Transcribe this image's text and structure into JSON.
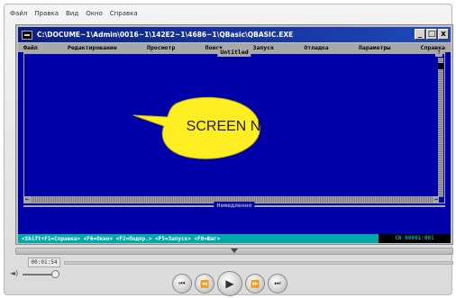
{
  "player": {
    "menu": [
      "Файл",
      "Правка",
      "Вид",
      "Окно",
      "Справка"
    ],
    "time": "00:01:54",
    "volume_label": "◄)",
    "volume_level": 0.9,
    "seek_position": 0.5
  },
  "window": {
    "title": "C:\\DOCUME~1\\Admin\\0016~1\\142E2~1\\4686~1\\QBasic\\QBASIC.EXE",
    "buttons": {
      "minimize": "_",
      "maximize": "□",
      "close": "x"
    }
  },
  "qbasic": {
    "menu": [
      "Файл",
      "Редактирование",
      "Просмотр",
      "Поиск",
      "Запуск",
      "Отладка",
      "Параметры",
      "Справка"
    ],
    "document_title": "Untitled",
    "immediate_label": "Немедленно",
    "status_text": "<Shift+F1=Справка> <F6=Окно> <F2=Подпр.> <F5=Запуск> <F8=Шаг>",
    "cursor_pos": "CN 00001:001"
  },
  "bubble": {
    "text": "SCREEN N"
  },
  "colors": {
    "qb_background": "#0000a8",
    "qb_menu": "#a8a8a8",
    "qb_status": "#00a8a8",
    "bubble_fill": "#ffee22",
    "titlebar": "#0b1e86"
  },
  "icons": {
    "prev": "skip-back-icon",
    "rewind": "rewind-icon",
    "play": "play-icon",
    "forward": "fast-forward-icon",
    "next": "skip-forward-icon"
  }
}
